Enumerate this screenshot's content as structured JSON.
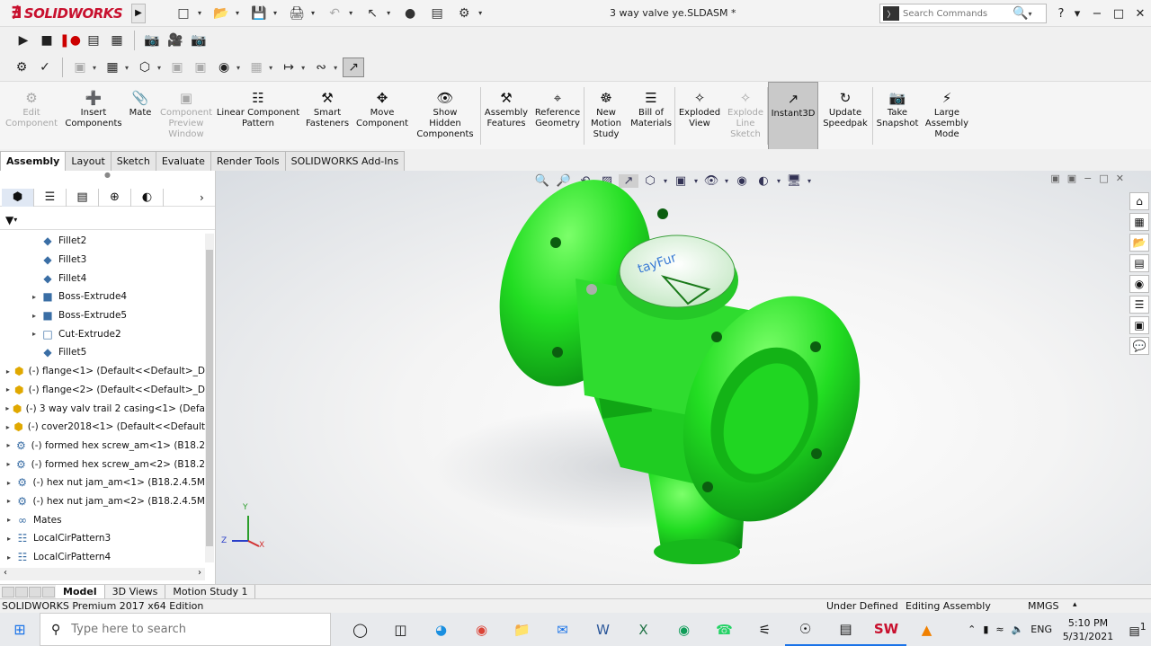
{
  "titlebar": {
    "logo_text": "SOLIDWORKS",
    "doc_title": "3 way valve ye.SLDASM *",
    "search_placeholder": "Search Commands",
    "help": "?",
    "minimize": "−",
    "restore": "□",
    "close": "✕"
  },
  "ribbon": {
    "items": [
      {
        "label": "Edit\nComponent",
        "icon": "⚙",
        "dim": true
      },
      {
        "label": "Insert\nComponents",
        "icon": "➕",
        "dim": false
      },
      {
        "label": "Mate",
        "icon": "📎",
        "dim": false
      },
      {
        "label": "Component\nPreview\nWindow",
        "icon": "▣",
        "dim": true
      },
      {
        "label": "Linear Component\nPattern",
        "icon": "☷",
        "dim": false
      },
      {
        "label": "Smart\nFasteners",
        "icon": "⚒",
        "dim": false
      },
      {
        "label": "Move\nComponent",
        "icon": "✥",
        "dim": false
      },
      {
        "label": "Show\nHidden\nComponents",
        "icon": "👁",
        "dim": false
      },
      {
        "label": "Assembly\nFeatures",
        "icon": "⚒",
        "dim": false
      },
      {
        "label": "Reference\nGeometry",
        "icon": "⌖",
        "dim": false
      },
      {
        "label": "New\nMotion\nStudy",
        "icon": "☸",
        "dim": false
      },
      {
        "label": "Bill of\nMaterials",
        "icon": "☰",
        "dim": false
      },
      {
        "label": "Exploded\nView",
        "icon": "✧",
        "dim": false
      },
      {
        "label": "Explode\nLine\nSketch",
        "icon": "✧",
        "dim": true
      },
      {
        "label": "Instant3D",
        "icon": "↗",
        "dim": false,
        "selected": true
      },
      {
        "label": "Update\nSpeedpak",
        "icon": "↻",
        "dim": false
      },
      {
        "label": "Take\nSnapshot",
        "icon": "📷",
        "dim": false
      },
      {
        "label": "Large\nAssembly\nMode",
        "icon": "⚡",
        "dim": false
      }
    ]
  },
  "tabs": [
    "Assembly",
    "Layout",
    "Sketch",
    "Evaluate",
    "Render Tools",
    "SOLIDWORKS Add-Ins"
  ],
  "tree": [
    {
      "indent": 2,
      "label": "Fillet2",
      "icon": "◆",
      "expand": false
    },
    {
      "indent": 2,
      "label": "Fillet3",
      "icon": "◆",
      "expand": false
    },
    {
      "indent": 2,
      "label": "Fillet4",
      "icon": "◆",
      "expand": false
    },
    {
      "indent": 2,
      "label": "Boss-Extrude4",
      "icon": "■",
      "expand": true
    },
    {
      "indent": 2,
      "label": "Boss-Extrude5",
      "icon": "■",
      "expand": true
    },
    {
      "indent": 2,
      "label": "Cut-Extrude2",
      "icon": "□",
      "expand": true
    },
    {
      "indent": 2,
      "label": "Fillet5",
      "icon": "◆",
      "expand": false
    },
    {
      "indent": 0,
      "label": "(-) flange<1> (Default<<Default>_D",
      "icon": "⬢",
      "expand": true
    },
    {
      "indent": 0,
      "label": "(-) flange<2> (Default<<Default>_D",
      "icon": "⬢",
      "expand": true
    },
    {
      "indent": 0,
      "label": "(-) 3 way valv trail 2 casing<1> (Defa",
      "icon": "⬢",
      "expand": true
    },
    {
      "indent": 0,
      "label": "(-) cover2018<1> (Default<<Default",
      "icon": "⬢",
      "expand": true
    },
    {
      "indent": 0,
      "label": "(-) formed hex screw_am<1> (B18.2",
      "icon": "⚙",
      "expand": true
    },
    {
      "indent": 0,
      "label": "(-) formed hex screw_am<2> (B18.2",
      "icon": "⚙",
      "expand": true
    },
    {
      "indent": 0,
      "label": "(-) hex nut jam_am<1> (B18.2.4.5M",
      "icon": "⚙",
      "expand": true
    },
    {
      "indent": 0,
      "label": "(-) hex nut jam_am<2> (B18.2.4.5M",
      "icon": "⚙",
      "expand": true
    },
    {
      "indent": 0,
      "label": "Mates",
      "icon": "∞",
      "expand": true
    },
    {
      "indent": 0,
      "label": "LocalCirPattern3",
      "icon": "☷",
      "expand": true
    },
    {
      "indent": 0,
      "label": "LocalCirPattern4",
      "icon": "☷",
      "expand": true
    }
  ],
  "model": {
    "cover_text": "tayFur"
  },
  "triad": {
    "x": "X",
    "y": "Y",
    "z": "Z"
  },
  "bottom_tabs": [
    "Model",
    "3D Views",
    "Motion Study 1"
  ],
  "status": {
    "edition": "SOLIDWORKS Premium 2017 x64 Edition",
    "state": "Under Defined",
    "mode": "Editing Assembly",
    "units": "MMGS",
    "units_arrow": "▴"
  },
  "taskbar": {
    "search_placeholder": "Type here to search",
    "lang": "ENG",
    "time": "5:10 PM",
    "date": "5/31/2021",
    "notif_count": "1"
  },
  "colors": {
    "model_green": "#2ee62e",
    "brand_red": "#c8102e"
  }
}
